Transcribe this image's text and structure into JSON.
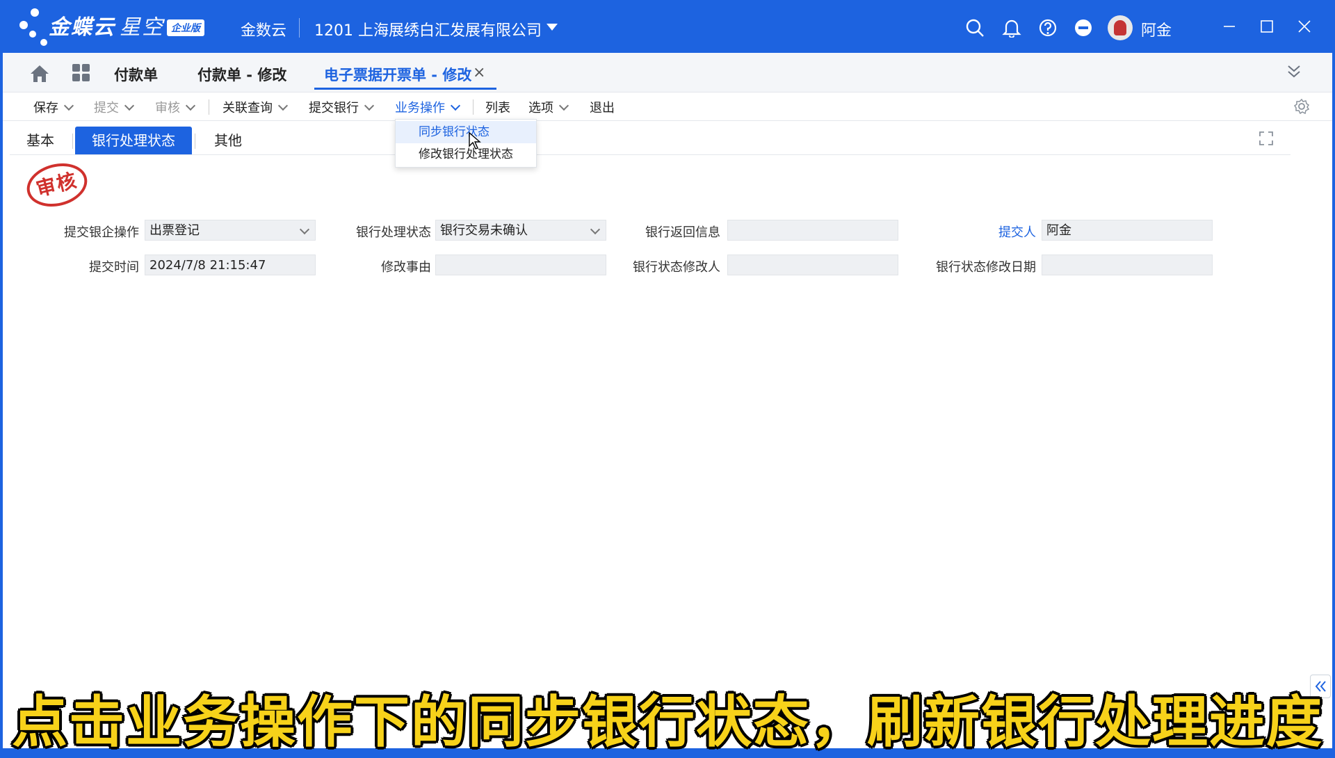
{
  "app": {
    "brand_main": "金蝶云",
    "brand_sub": "星空",
    "badge": "企业版",
    "cloud_name": "金数云",
    "company": "1201  上海展绣白汇发展有限公司",
    "user_name": "阿金"
  },
  "tabs": {
    "items": [
      "付款单",
      "付款单 - 修改",
      "电子票据开票单 - 修改"
    ],
    "close_glyph": "×"
  },
  "toolbar": {
    "save": "保存",
    "submit": "提交",
    "audit": "审核",
    "related_query": "关联查询",
    "submit_bank": "提交银行",
    "business_ops": "业务操作",
    "list": "列表",
    "options": "选项",
    "exit": "退出"
  },
  "dropdown": {
    "items": [
      "同步银行状态",
      "修改银行处理状态"
    ]
  },
  "subtabs": {
    "items": [
      "基本",
      "银行处理状态",
      "其他"
    ]
  },
  "stamp_text": "审核",
  "form": {
    "submit_op_label": "提交银企操作",
    "submit_op_value": "出票登记",
    "bank_status_label": "银行处理状态",
    "bank_status_value": "银行交易未确认",
    "bank_return_label": "银行返回信息",
    "bank_return_value": "",
    "submitter_label": "提交人",
    "submitter_value": "阿金",
    "submit_time_label": "提交时间",
    "submit_time_value": "2024/7/8 21:15:47",
    "modify_reason_label": "修改事由",
    "modify_reason_value": "",
    "status_modifier_label": "银行状态修改人",
    "status_modifier_value": "",
    "status_modify_date_label": "银行状态修改日期",
    "status_modify_date_value": ""
  },
  "caption": "点击业务操作下的同步银行状态，刷新银行处理进度",
  "colors": {
    "primary": "#1d63e0",
    "stamp": "#d0312d",
    "caption": "#f7d21a"
  }
}
